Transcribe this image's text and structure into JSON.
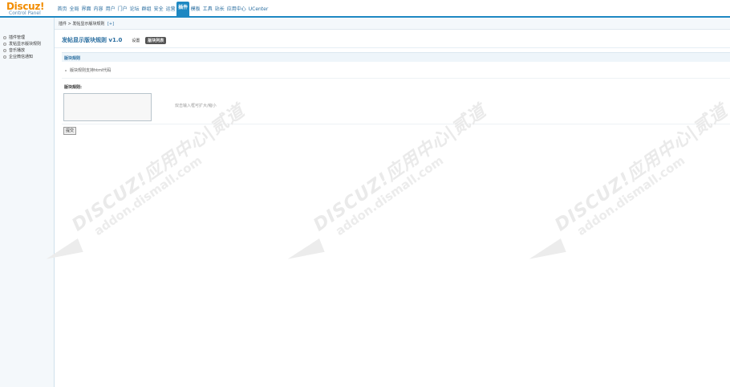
{
  "header": {
    "logo_main": "Discuz!",
    "logo_sub": "Control Panel",
    "nav": [
      {
        "label": "首页",
        "active": false
      },
      {
        "label": "全局",
        "active": false
      },
      {
        "label": "界面",
        "active": false
      },
      {
        "label": "内容",
        "active": false
      },
      {
        "label": "用户",
        "active": false
      },
      {
        "label": "门户",
        "active": false
      },
      {
        "label": "论坛",
        "active": false
      },
      {
        "label": "群组",
        "active": false
      },
      {
        "label": "安全",
        "active": false
      },
      {
        "label": "运营",
        "active": false
      },
      {
        "label": "插件",
        "active": true
      },
      {
        "label": "模板",
        "active": false
      },
      {
        "label": "工具",
        "active": false
      },
      {
        "label": "站长",
        "active": false
      },
      {
        "label": "应用中心",
        "active": false
      },
      {
        "label": "UCenter",
        "active": false
      }
    ]
  },
  "sidebar": {
    "items": [
      {
        "label": "插件管理"
      },
      {
        "label": "发帖显示版块规则"
      },
      {
        "label": "音乐播放"
      },
      {
        "label": "企业微信通知"
      }
    ]
  },
  "breadcrumb": {
    "text": "插件 > 发帖显示版块规则",
    "plus": "[+]"
  },
  "main": {
    "title": "发帖显示版块规则 v1.0",
    "tabs": [
      {
        "label": "设置",
        "active": false
      },
      {
        "label": "版块列表",
        "active": true
      }
    ],
    "section_title": "版块规则",
    "tip": "版块规则支持html代码",
    "field_label": "版块规则:",
    "textarea_value": "",
    "hint": "双击输入框可扩大/缩小",
    "submit_label": "提交"
  },
  "watermark": {
    "line1": "DISCUZ!应用中心|贰道",
    "line2": "addon.dismall.com"
  },
  "colors": {
    "accent": "#1e88c2",
    "logo": "#f28c00",
    "link": "#2a6ea0",
    "sidebar_bg": "#f4f8fb"
  }
}
